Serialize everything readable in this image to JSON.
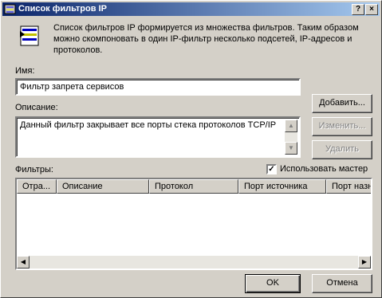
{
  "window": {
    "title": "Список фильтров IP",
    "close_label": "×",
    "help_label": "?"
  },
  "info": {
    "text": "Список фильтров IP формируется из множества фильтров. Таким образом можно скомпоновать в один IP-фильтр несколько подсетей, IP-адресов и протоколов.",
    "icon": "filter-list-icon"
  },
  "name": {
    "label": "Имя:",
    "value": "Фильтр запрета сервисов"
  },
  "description": {
    "label": "Описание:",
    "value": "Данный фильтр закрывает все порты стека протоколов TCP/IP"
  },
  "buttons": {
    "add": "Добавить...",
    "edit": "Изменить...",
    "delete": "Удалить",
    "ok": "OK",
    "cancel": "Отмена"
  },
  "filters": {
    "label": "Фильтры:",
    "use_wizard_label": "Использовать мастер",
    "use_wizard_checked": true,
    "columns": [
      "Отра...",
      "Описание",
      "Протокол",
      "Порт источника",
      "Порт назна..."
    ],
    "rows": []
  },
  "colors": {
    "title_start": "#0a246a",
    "title_end": "#a6caf0",
    "face": "#d4d0c8"
  }
}
